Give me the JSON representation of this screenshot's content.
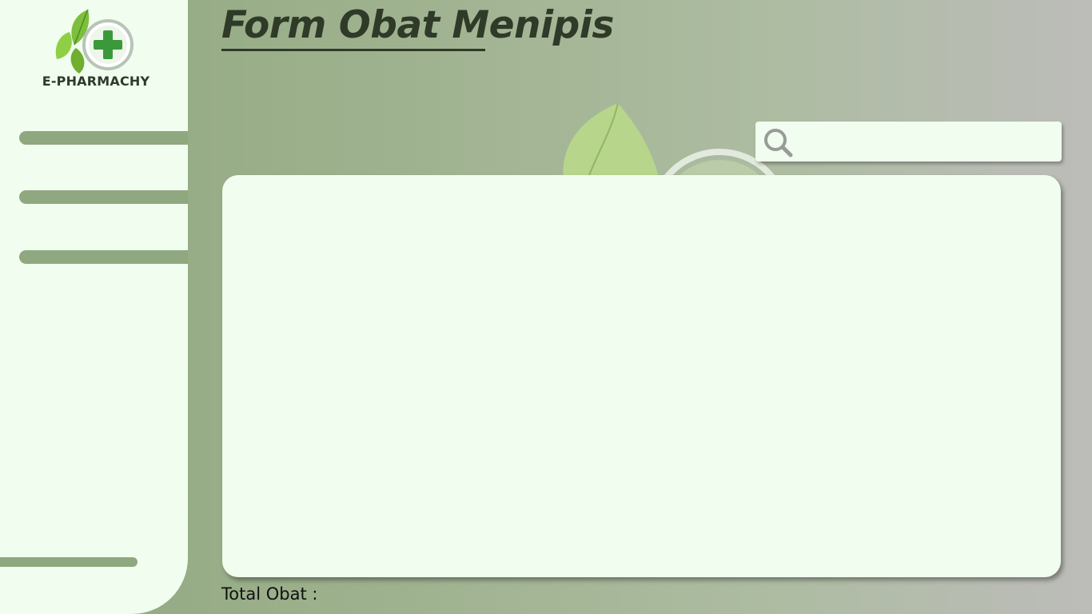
{
  "brand": {
    "name": "E-PHARMACHY",
    "logo_icon": "leaf-cross-logo-icon"
  },
  "sidebar": {
    "items": [
      {
        "label": ""
      },
      {
        "label": ""
      },
      {
        "label": ""
      }
    ],
    "bottom_item": {
      "label": ""
    }
  },
  "page": {
    "title": "Form Obat Menipis"
  },
  "search": {
    "icon": "search-icon",
    "value": "",
    "placeholder": ""
  },
  "table": {
    "rows": []
  },
  "footer": {
    "total_label": "Total Obat :"
  },
  "colors": {
    "sidebar_bg": "#f0fdef",
    "accent_green": "#8fa87f",
    "title_text": "#2f3a28",
    "panel_bg": "#f0fdef"
  }
}
